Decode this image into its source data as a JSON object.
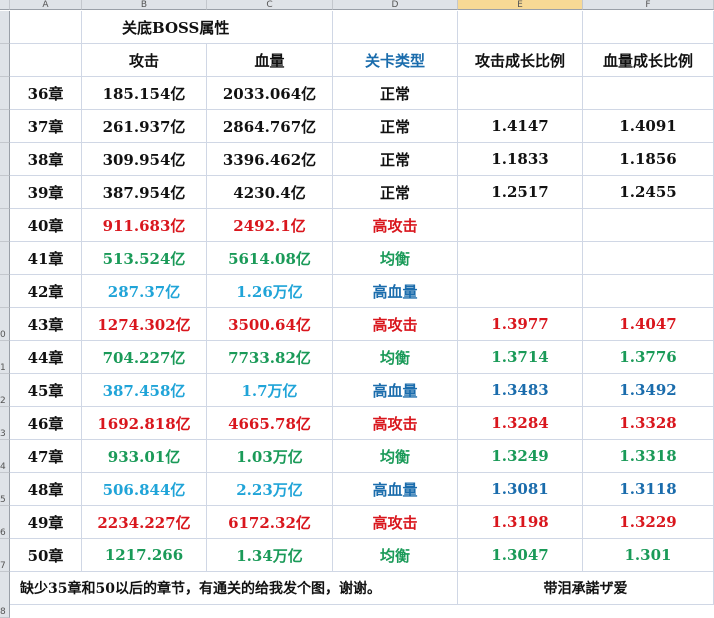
{
  "colors": {
    "black": "#111111",
    "red": "#d9161d",
    "green": "#1a9a58",
    "cyan": "#20a4d8",
    "blue": "#1a6cac"
  },
  "columns": [
    "A",
    "B",
    "C",
    "D",
    "E",
    "F"
  ],
  "row_labels": [
    "",
    "",
    "",
    "",
    "",
    "",
    "",
    "",
    "",
    "0",
    "1",
    "2",
    "3",
    "4",
    "5",
    "6",
    "7",
    "8"
  ],
  "title": "关底BOSS属性",
  "headers": [
    {
      "text": "",
      "color": "black"
    },
    {
      "text": "攻击",
      "color": "black"
    },
    {
      "text": "血量",
      "color": "black"
    },
    {
      "text": "关卡类型",
      "color": "blue"
    },
    {
      "text": "攻击成长比例",
      "color": "black"
    },
    {
      "text": "血量成长比例",
      "color": "black"
    }
  ],
  "rows": [
    {
      "chapter": "36章",
      "attack": "185.154亿",
      "hp": "2033.064亿",
      "type": "正常",
      "atk_ratio": "",
      "hp_ratio": "",
      "color": "black",
      "ratio_color": "black"
    },
    {
      "chapter": "37章",
      "attack": "261.937亿",
      "hp": "2864.767亿",
      "type": "正常",
      "atk_ratio": "1.4147",
      "hp_ratio": "1.4091",
      "color": "black",
      "ratio_color": "black"
    },
    {
      "chapter": "38章",
      "attack": "309.954亿",
      "hp": "3396.462亿",
      "type": "正常",
      "atk_ratio": "1.1833",
      "hp_ratio": "1.1856",
      "color": "black",
      "ratio_color": "black"
    },
    {
      "chapter": "39章",
      "attack": "387.954亿",
      "hp": "4230.4亿",
      "type": "正常",
      "atk_ratio": "1.2517",
      "hp_ratio": "1.2455",
      "color": "black",
      "ratio_color": "black"
    },
    {
      "chapter": "40章",
      "attack": "911.683亿",
      "hp": "2492.1亿",
      "type": "高攻击",
      "atk_ratio": "",
      "hp_ratio": "",
      "color": "red",
      "ratio_color": "red"
    },
    {
      "chapter": "41章",
      "attack": "513.524亿",
      "hp": "5614.08亿",
      "type": "均衡",
      "atk_ratio": "",
      "hp_ratio": "",
      "color": "green",
      "ratio_color": "green"
    },
    {
      "chapter": "42章",
      "attack": "287.37亿",
      "hp": "1.26万亿",
      "type": "高血量",
      "atk_ratio": "",
      "hp_ratio": "",
      "color": "cyan",
      "type_color": "blue",
      "ratio_color": "blue"
    },
    {
      "chapter": "43章",
      "attack": "1274.302亿",
      "hp": "3500.64亿",
      "type": "高攻击",
      "atk_ratio": "1.3977",
      "hp_ratio": "1.4047",
      "color": "red",
      "ratio_color": "red"
    },
    {
      "chapter": "44章",
      "attack": "704.227亿",
      "hp": "7733.82亿",
      "type": "均衡",
      "atk_ratio": "1.3714",
      "hp_ratio": "1.3776",
      "color": "green",
      "ratio_color": "green"
    },
    {
      "chapter": "45章",
      "attack": "387.458亿",
      "hp": "1.7万亿",
      "type": "高血量",
      "atk_ratio": "1.3483",
      "hp_ratio": "1.3492",
      "color": "cyan",
      "type_color": "blue",
      "ratio_color": "blue"
    },
    {
      "chapter": "46章",
      "attack": "1692.818亿",
      "hp": "4665.78亿",
      "type": "高攻击",
      "atk_ratio": "1.3284",
      "hp_ratio": "1.3328",
      "color": "red",
      "ratio_color": "red"
    },
    {
      "chapter": "47章",
      "attack": "933.01亿",
      "hp": "1.03万亿",
      "type": "均衡",
      "atk_ratio": "1.3249",
      "hp_ratio": "1.3318",
      "color": "green",
      "ratio_color": "green"
    },
    {
      "chapter": "48章",
      "attack": "506.844亿",
      "hp": "2.23万亿",
      "type": "高血量",
      "atk_ratio": "1.3081",
      "hp_ratio": "1.3118",
      "color": "cyan",
      "type_color": "blue",
      "ratio_color": "blue"
    },
    {
      "chapter": "49章",
      "attack": "2234.227亿",
      "hp": "6172.32亿",
      "type": "高攻击",
      "atk_ratio": "1.3198",
      "hp_ratio": "1.3229",
      "color": "red",
      "ratio_color": "red"
    },
    {
      "chapter": "50章",
      "attack": "1217.266",
      "hp": "1.34万亿",
      "type": "均衡",
      "atk_ratio": "1.3047",
      "hp_ratio": "1.301",
      "color": "green",
      "ratio_color": "green"
    }
  ],
  "footer": {
    "note": "缺少35章和50以后的章节，有通关的给我发个图，谢谢。",
    "signature": "带泪承諾ザ爱"
  }
}
